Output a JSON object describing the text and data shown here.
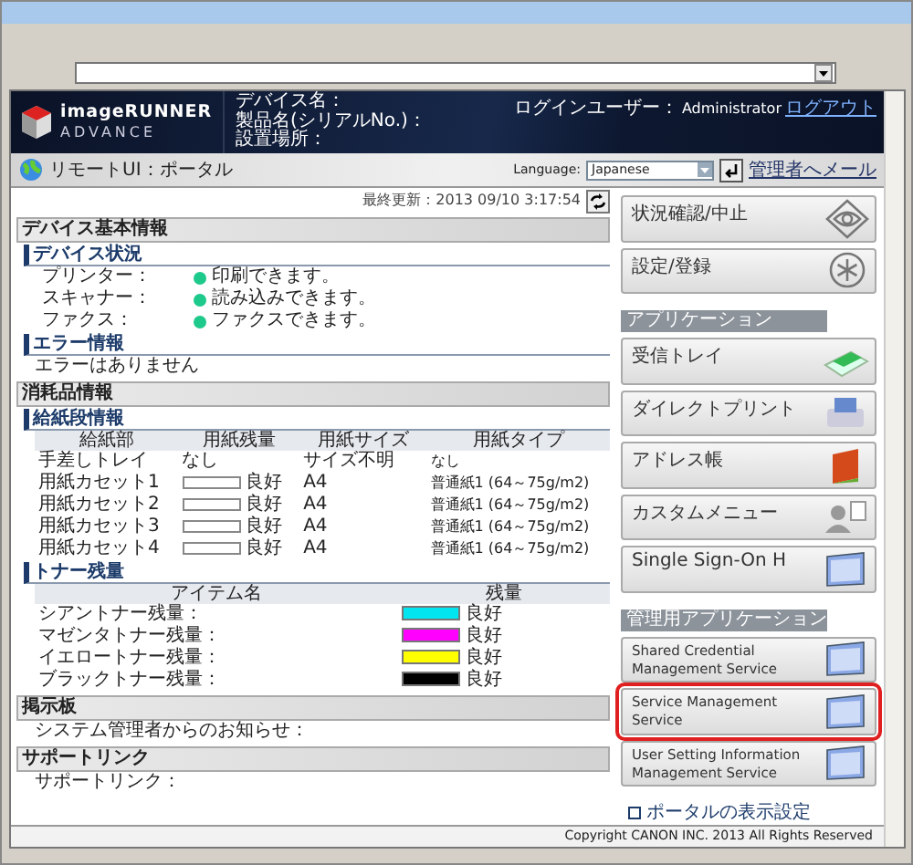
{
  "header": {
    "logo_line1": "imageRUNNER",
    "logo_line2": "ADVANCE",
    "device_fields": [
      "デバイス名：",
      "製品名(シリアルNo.)：",
      "設置場所："
    ],
    "login_label": "ログインユーザー：",
    "user": "Administrator",
    "logout": "ログアウト"
  },
  "subheader": {
    "title": "リモートUI：ポータル",
    "language_label": "Language:",
    "language": "Japanese",
    "mail_link": "管理者へメール"
  },
  "last_updated": "最終更新：2013 09/10 3:17:54",
  "device_info": {
    "title": "デバイス基本情報",
    "status": {
      "title": "デバイス状況",
      "items": [
        {
          "label": "プリンター：",
          "text": "印刷できます。",
          "color": "#1ec98c"
        },
        {
          "label": "スキャナー：",
          "text": "読み込みできます。",
          "color": "#1ec98c"
        },
        {
          "label": "ファクス：",
          "text": "ファクスできます。",
          "color": "#1ec98c"
        }
      ]
    },
    "error": {
      "title": "エラー情報",
      "text": "エラーはありません"
    }
  },
  "consumables": {
    "title": "消耗品情報",
    "paper": {
      "title": "給紙段情報",
      "columns": [
        "給紙部",
        "用紙残量",
        "用紙サイズ",
        "用紙タイプ"
      ],
      "rows": [
        {
          "kind": "text",
          "source": "手差しトレイ",
          "amount": "なし",
          "size": "サイズ不明",
          "type": "なし"
        },
        {
          "kind": "meter",
          "source": "用紙カセット1",
          "amount": "良好",
          "size": "A4",
          "type": "普通紙1 (64～75g/m2)"
        },
        {
          "kind": "meter",
          "source": "用紙カセット2",
          "amount": "良好",
          "size": "A4",
          "type": "普通紙1 (64～75g/m2)"
        },
        {
          "kind": "meter",
          "source": "用紙カセット3",
          "amount": "良好",
          "size": "A4",
          "type": "普通紙1 (64～75g/m2)"
        },
        {
          "kind": "meter",
          "source": "用紙カセット4",
          "amount": "良好",
          "size": "A4",
          "type": "普通紙1 (64～75g/m2)"
        }
      ]
    },
    "toner": {
      "title": "トナー残量",
      "columns": [
        "アイテム名",
        "残量"
      ],
      "rows": [
        {
          "name": "シアントナー残量：",
          "color": "#00e5f0",
          "reading": "良好"
        },
        {
          "name": "マゼンタトナー残量：",
          "color": "#ff00ff",
          "reading": "良好"
        },
        {
          "name": "イエロートナー残量：",
          "color": "#ffff00",
          "reading": "良好"
        },
        {
          "name": "ブラックトナー残量：",
          "color": "#000000",
          "reading": "良好"
        }
      ]
    }
  },
  "bulletin": {
    "title": "掲示板",
    "text": "システム管理者からのお知らせ："
  },
  "support": {
    "title": "サポートリンク",
    "text": "サポートリンク："
  },
  "top_buttons": [
    {
      "label": "状況確認/中止",
      "kind": "eye"
    },
    {
      "label": "設定/登録",
      "kind": "gear"
    }
  ],
  "applications": {
    "title": "アプリケーション",
    "items": [
      {
        "label": "受信トレイ",
        "kind": "tray",
        "highlighted": false
      },
      {
        "label": "ダイレクトプリント",
        "kind": "printer",
        "highlighted": false
      },
      {
        "label": "アドレス帳",
        "kind": "book",
        "highlighted": false
      },
      {
        "label": "カスタムメニュー",
        "kind": "person",
        "highlighted": false
      },
      {
        "label": "Single Sign-On H",
        "kind": "window",
        "highlighted": false
      }
    ]
  },
  "admin_applications": {
    "title": "管理用アプリケーション",
    "items": [
      {
        "label": "Shared Credential Management Service",
        "kind": "window",
        "highlighted": false
      },
      {
        "label": "Service Management Service",
        "kind": "window",
        "highlighted": true
      },
      {
        "label": "User Setting Information Management Service",
        "kind": "window",
        "highlighted": false
      }
    ]
  },
  "portal_settings_link": "ポータルの表示設定",
  "copyright": "Copyright CANON INC. 2013 All Rights Reserved"
}
